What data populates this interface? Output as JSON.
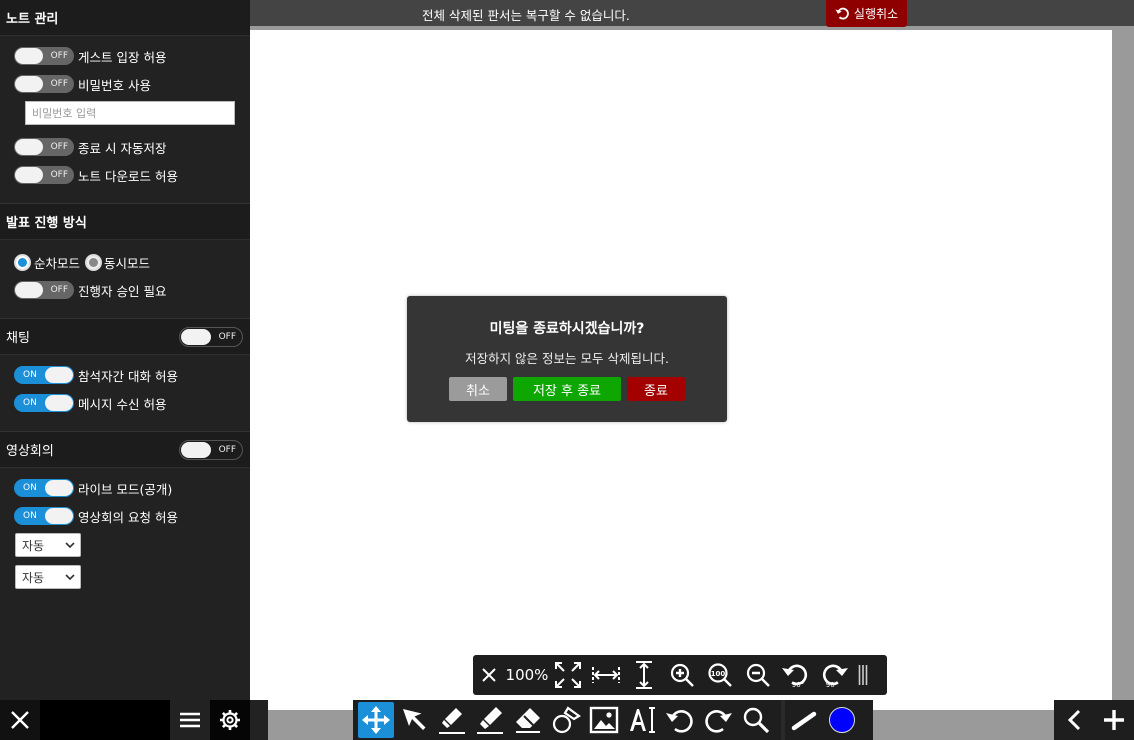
{
  "sidebar": {
    "note": {
      "title": "노트 관리",
      "guest": {
        "label": "게스트 입장 허용",
        "state": "OFF"
      },
      "password": {
        "label": "비밀번호 사용",
        "state": "OFF",
        "placeholder": "비밀번호 입력"
      },
      "autosave": {
        "label": "종료 시 자동저장",
        "state": "OFF"
      },
      "download": {
        "label": "노트 다운로드 허용",
        "state": "OFF"
      }
    },
    "presentation": {
      "title": "발표 진행 방식",
      "mode_seq": "순차모드",
      "mode_sync": "동시모드",
      "approval": {
        "label": "진행자 승인 필요",
        "state": "OFF"
      }
    },
    "chat": {
      "title": "채팅",
      "state": "OFF",
      "peer": {
        "label": "참석자간 대화 허용",
        "state": "ON"
      },
      "receive": {
        "label": "메시지 수신 허용",
        "state": "ON"
      }
    },
    "video": {
      "title": "영상회의",
      "state": "OFF",
      "live": {
        "label": "라이브 모드(공개)",
        "state": "ON"
      },
      "request": {
        "label": "영상회의 요청 허용",
        "state": "ON"
      },
      "select1": "자동",
      "select2": "자동"
    }
  },
  "topbar": {
    "message": "전체 삭제된 판서는 복구할 수 없습니다.",
    "undo_label": "실행취소"
  },
  "dialog": {
    "title": "미팅을 종료하시겠습니까?",
    "message": "저장하지 않은 정보는 모두 삭제됩니다.",
    "cancel": "취소",
    "save_quit": "저장 후 종료",
    "quit": "종료"
  },
  "zoombar": {
    "zoom": "100%",
    "rotate_badge": "90°"
  },
  "colors": {
    "accent": "#1b8fd8",
    "danger": "#a30000",
    "success": "#0ea600",
    "pen": "#0000ff"
  }
}
